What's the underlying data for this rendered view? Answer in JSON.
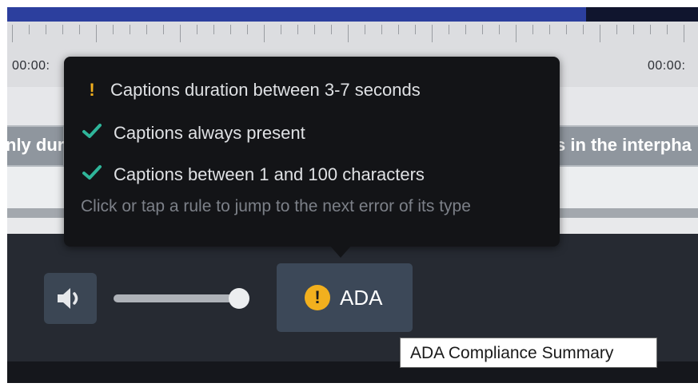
{
  "timeline": {
    "time_left": "00:00:",
    "time_right": "00:00:"
  },
  "caption_track": {
    "left_text": "nly dur",
    "right_text": "s in the interpha"
  },
  "compliance_popup": {
    "rules": [
      {
        "status": "warning",
        "icon": "exclamation-icon",
        "label": "Captions duration between 3-7 seconds"
      },
      {
        "status": "pass",
        "icon": "checkmark-icon",
        "label": "Captions always present"
      },
      {
        "status": "pass",
        "icon": "checkmark-icon",
        "label": "Captions between 1 and 100 characters"
      }
    ],
    "hint": "Click or tap a rule to jump to the next error of its type"
  },
  "controls": {
    "volume_icon": "speaker-icon",
    "volume_level": 0.9,
    "ada_button": {
      "icon": "warning-circle-icon",
      "icon_glyph": "!",
      "label": "ADA"
    }
  },
  "tooltip": {
    "text": "ADA Compliance Summary"
  },
  "colors": {
    "warning": "#f2b01e",
    "check": "#2fb59a",
    "popup_bg": "#131417",
    "control_bg": "#262a32",
    "button_bg": "#3c4858"
  }
}
